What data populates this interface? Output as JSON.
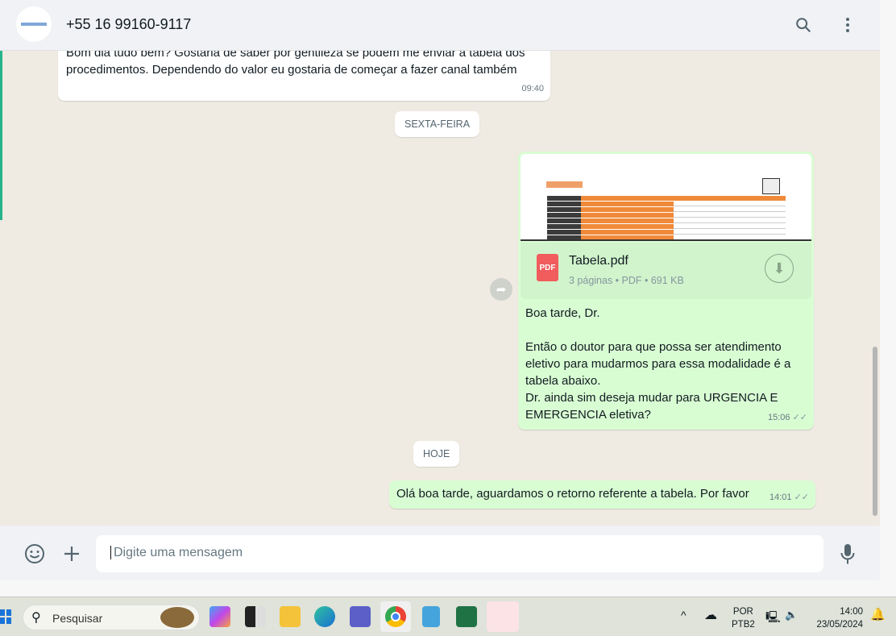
{
  "header": {
    "contact": "+55 16 99160-9117",
    "search_icon": "search-icon",
    "menu_icon": "kebab-menu-icon"
  },
  "messages": [
    {
      "direction": "in",
      "text": "Bom dia tudo bem? Gostaria de saber por gentileza se podem me enviar a tabela dos procedimentos. Dependendo do valor eu gostaria de começar a fazer canal também",
      "time": "09:40"
    },
    {
      "type": "date",
      "label": "SEXTA-FEIRA"
    },
    {
      "direction": "out",
      "document": {
        "name": "Tabela.pdf",
        "meta": "3 páginas • PDF • 691 KB",
        "icon_label": "PDF"
      },
      "lines": [
        "Boa tarde, Dr.",
        "",
        "Então o doutor para que possa ser atendimento eletivo para mudarmos para essa modalidade é a tabela abaixo.",
        "Dr. ainda sim deseja mudar para URGENCIA E EMERGENCIA eletiva?"
      ],
      "time": "15:06",
      "status": "read"
    },
    {
      "type": "date",
      "label": "HOJE"
    },
    {
      "direction": "out",
      "text": "Olá boa tarde, aguardamos o retorno referente a tabela. Por favor",
      "time": "14:01",
      "status": "read"
    }
  ],
  "composer": {
    "placeholder": "Digite uma mensagem"
  },
  "taskbar": {
    "search": "Pesquisar",
    "lang1": "POR",
    "lang2": "PTB2",
    "time": "14:00",
    "date": "23/05/2024"
  },
  "colors": {
    "outgoing": "#d9fdd3",
    "incoming": "#ffffff",
    "pdf": "#f15c5c"
  }
}
